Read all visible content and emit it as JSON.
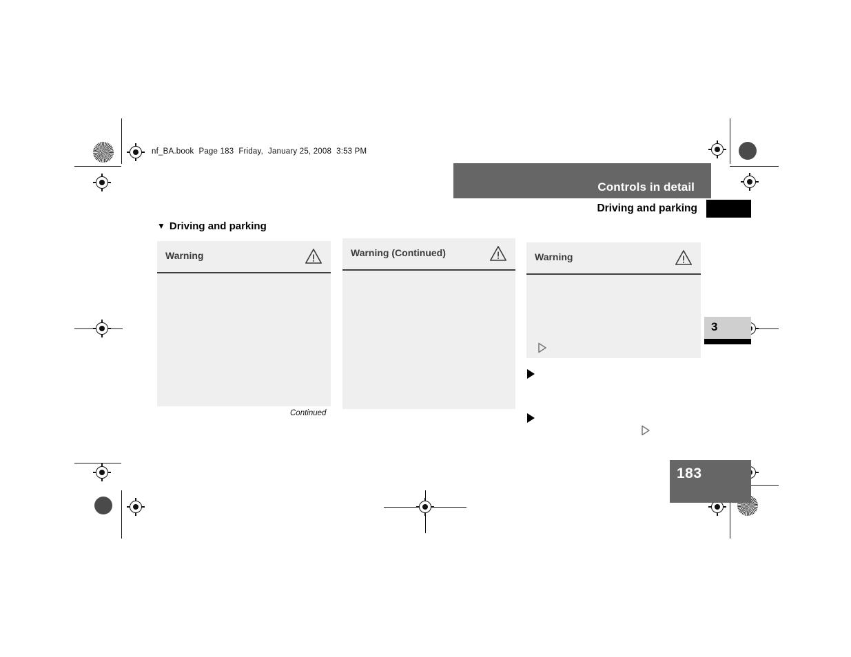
{
  "document": {
    "filestamp": {
      "filename": "nf_BA.book",
      "page_label": "Page 183",
      "weekday": "Friday,",
      "date": "January 25, 2008",
      "time": "3:53 PM"
    },
    "page_number": "183",
    "chapter_number": "3"
  },
  "header": {
    "title": "Controls in detail",
    "subtitle": "Driving and parking"
  },
  "section": {
    "caret": "▼",
    "heading": "Driving and parking"
  },
  "warning_boxes": [
    {
      "title": "Warning",
      "icon": "warning-triangle-icon",
      "body": ""
    },
    {
      "title": "Warning (Continued)",
      "icon": "warning-triangle-icon",
      "body": ""
    },
    {
      "title": "Warning",
      "icon": "warning-triangle-icon",
      "body": ""
    }
  ],
  "footnotes": {
    "continued": "Continued"
  },
  "markers": {
    "hollow_triangle": "hollow-right-triangle-icon",
    "solid_triangle": "solid-right-triangle-icon"
  },
  "colors": {
    "header_band": "#666666",
    "warning_box": "#efefef",
    "chapter_tab": "#cfcfcf",
    "folio_block": "#666666",
    "rule": "#3d3d3d",
    "black_bar": "#000000"
  }
}
